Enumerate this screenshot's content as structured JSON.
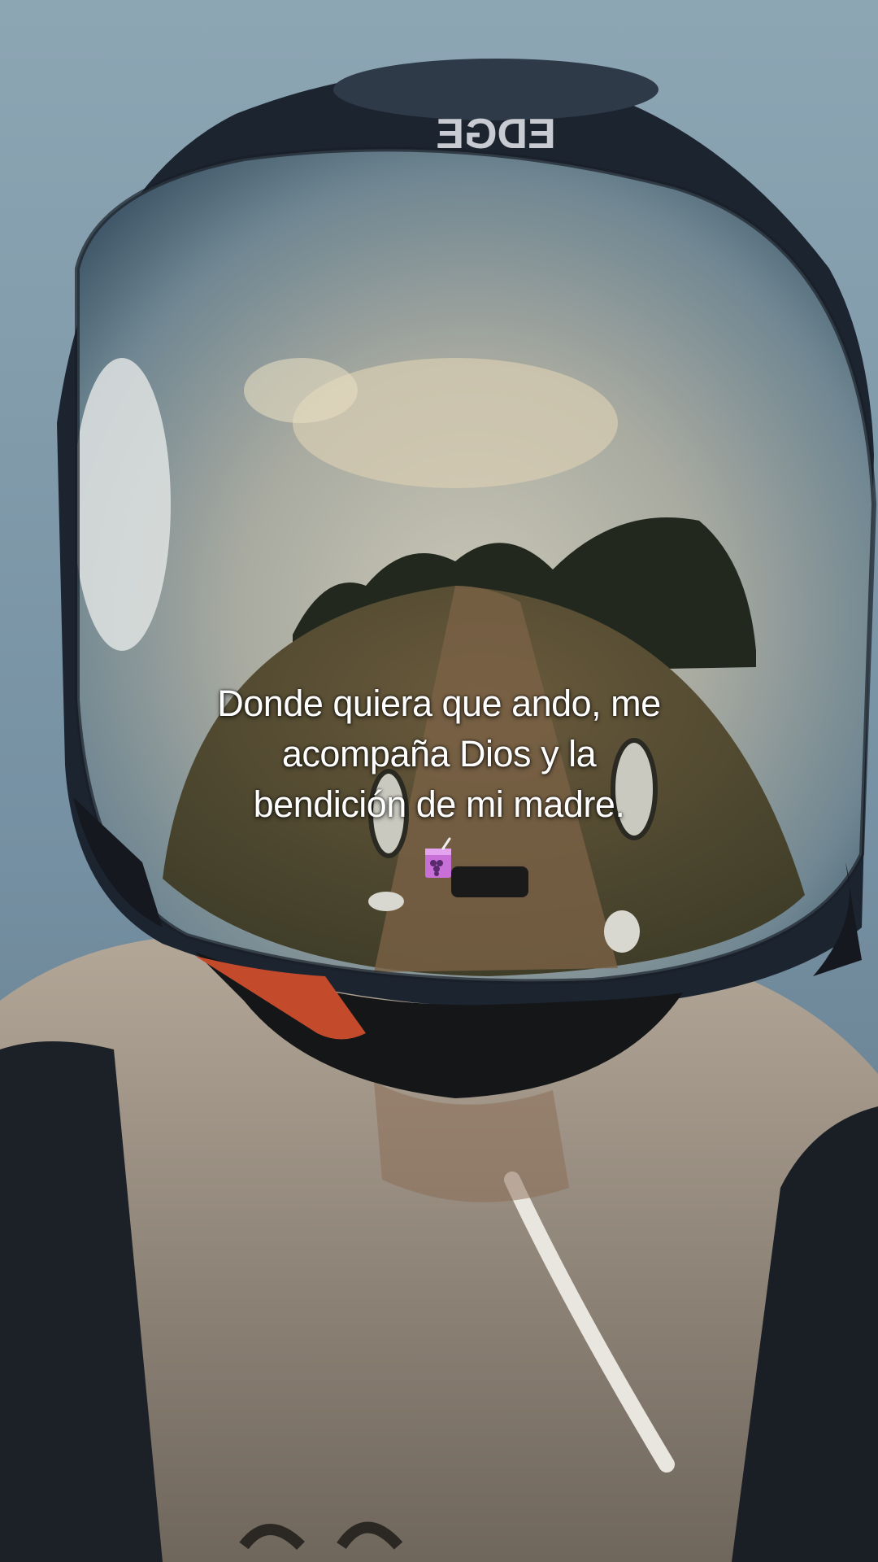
{
  "photo": {
    "helmet_brand": "EDGE",
    "colors": {
      "sky": "#7c96a6",
      "helmet_shell": "#1c2430",
      "visor_sky_reflection": "#b8c3c4",
      "road_reflection": "#5a4a32",
      "hoodie": "#9c9183",
      "chin_strap": "#c44a2c"
    }
  },
  "caption": {
    "line1": "Donde quiera que ando, me",
    "line2": "acompaña Dios y la",
    "line3": "bendición de mi madre.",
    "emoji_icon": "juice-box-grape-icon"
  }
}
